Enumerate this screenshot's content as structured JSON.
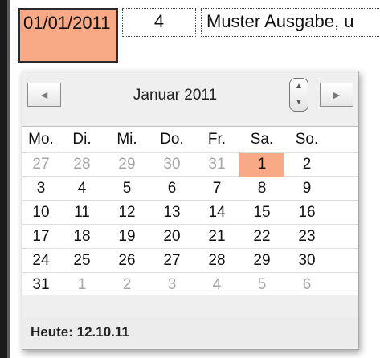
{
  "row": {
    "date_cell": "01/01/2011",
    "number_cell": "4",
    "text_cell": "Muster Ausgabe, u"
  },
  "calendar": {
    "month_title": "Januar 2011",
    "prev_icon": "◄",
    "next_icon": "►",
    "stepper_up_icon": "▲",
    "stepper_down_icon": "▼",
    "weekdays": [
      "Mo.",
      "Di.",
      "Mi.",
      "Do.",
      "Fr.",
      "Sa.",
      "So."
    ],
    "weeks": [
      [
        {
          "d": "27",
          "other": true
        },
        {
          "d": "28",
          "other": true
        },
        {
          "d": "29",
          "other": true
        },
        {
          "d": "30",
          "other": true
        },
        {
          "d": "31",
          "other": true
        },
        {
          "d": "1",
          "selected": true
        },
        {
          "d": "2"
        }
      ],
      [
        {
          "d": "3"
        },
        {
          "d": "4"
        },
        {
          "d": "5"
        },
        {
          "d": "6"
        },
        {
          "d": "7"
        },
        {
          "d": "8"
        },
        {
          "d": "9"
        }
      ],
      [
        {
          "d": "10"
        },
        {
          "d": "11"
        },
        {
          "d": "12"
        },
        {
          "d": "13"
        },
        {
          "d": "14"
        },
        {
          "d": "15"
        },
        {
          "d": "16"
        }
      ],
      [
        {
          "d": "17"
        },
        {
          "d": "18"
        },
        {
          "d": "19"
        },
        {
          "d": "20"
        },
        {
          "d": "21"
        },
        {
          "d": "22"
        },
        {
          "d": "23"
        }
      ],
      [
        {
          "d": "24"
        },
        {
          "d": "25"
        },
        {
          "d": "26"
        },
        {
          "d": "27"
        },
        {
          "d": "28"
        },
        {
          "d": "29"
        },
        {
          "d": "30"
        }
      ],
      [
        {
          "d": "31"
        },
        {
          "d": "1",
          "other": true
        },
        {
          "d": "2",
          "other": true
        },
        {
          "d": "3",
          "other": true
        },
        {
          "d": "4",
          "other": true
        },
        {
          "d": "5",
          "other": true
        },
        {
          "d": "6",
          "other": true
        }
      ]
    ],
    "today_label": "Heute: 12.10.11"
  },
  "colors": {
    "selected": "#f7aa85",
    "other_month": "#a6a6a6"
  }
}
